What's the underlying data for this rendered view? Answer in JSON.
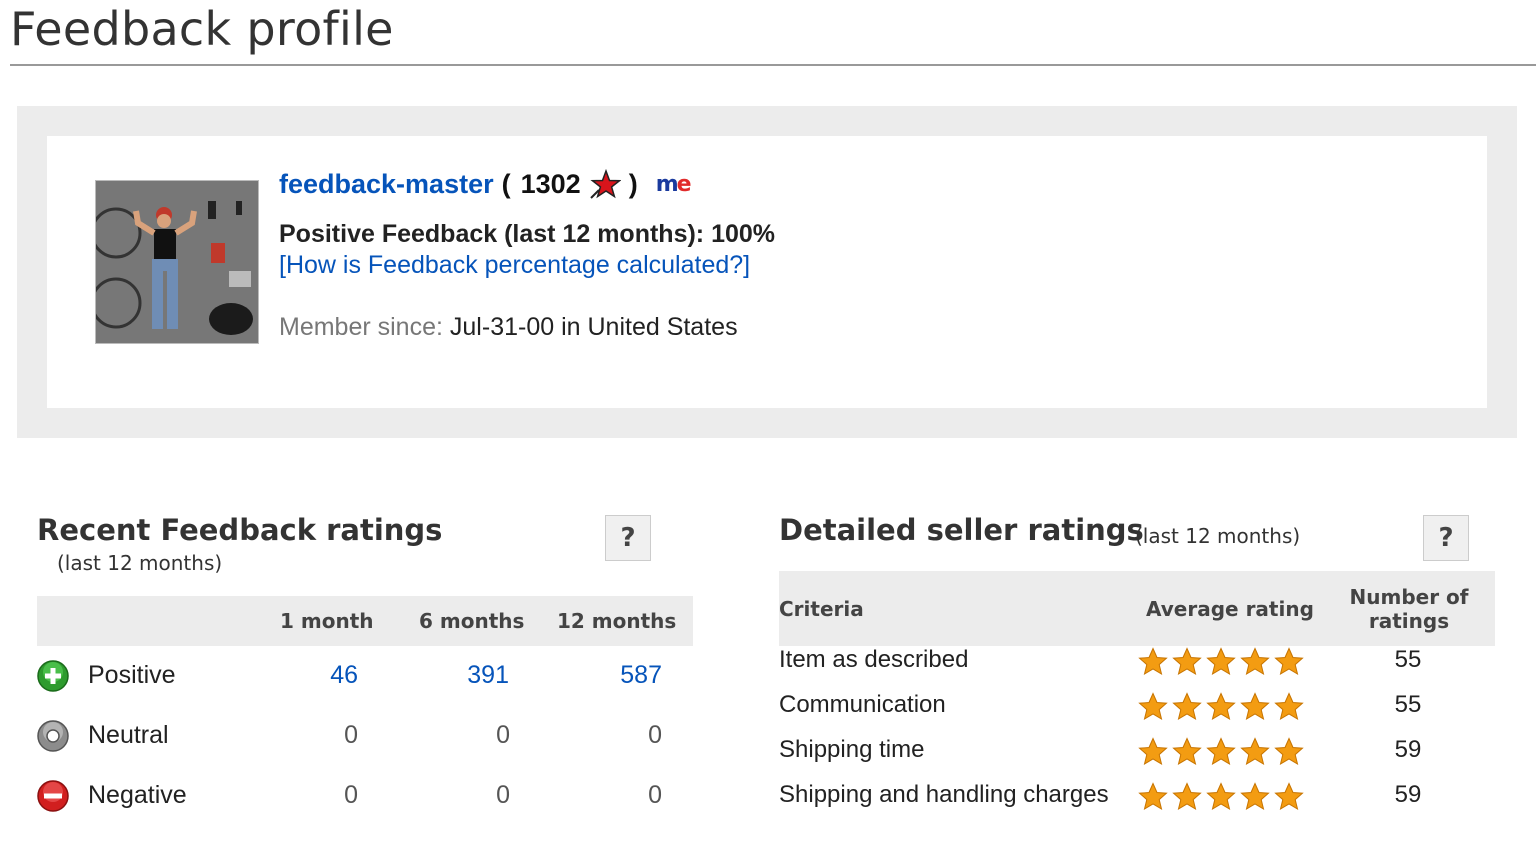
{
  "page": {
    "title": "Feedback profile"
  },
  "profile": {
    "username": "feedback-master",
    "paren_open": "(",
    "paren_close": ")",
    "score": "1302",
    "star_icon": "red-shooting-star-icon",
    "me_icon": {
      "m": "m",
      "e": "e"
    },
    "positive_feedback": "Positive Feedback (last 12 months): 100%",
    "how_link": "[How is Feedback percentage calculated?]",
    "member_since_label": "Member since:",
    "member_since_value": "Jul-31-00 in United States"
  },
  "recent": {
    "title": "Recent Feedback ratings",
    "subtitle": "(last 12 months)",
    "help": "?",
    "columns": [
      "1 month",
      "6 months",
      "12 months"
    ],
    "rows": [
      {
        "label": "Positive",
        "icon": "positive-plus-icon",
        "values": [
          "46",
          "391",
          "587"
        ]
      },
      {
        "label": "Neutral",
        "icon": "neutral-circle-icon",
        "values": [
          "0",
          "0",
          "0"
        ]
      },
      {
        "label": "Negative",
        "icon": "negative-minus-icon",
        "values": [
          "0",
          "0",
          "0"
        ]
      }
    ]
  },
  "detailed": {
    "title": "Detailed seller ratings",
    "subtitle": "(last 12 months)",
    "help": "?",
    "col_criteria": "Criteria",
    "col_avg": "Average rating",
    "col_num_1": "Number of",
    "col_num_2": "ratings",
    "rows": [
      {
        "criteria": "Item as described",
        "stars": 5,
        "count": "55"
      },
      {
        "criteria": "Communication",
        "stars": 5,
        "count": "55"
      },
      {
        "criteria": "Shipping time",
        "stars": 5,
        "count": "59"
      },
      {
        "criteria": "Shipping and handling charges",
        "stars": 5,
        "count": "59"
      }
    ]
  },
  "colors": {
    "link": "#0654ba",
    "star": "#f39c12",
    "panel": "#ececec"
  }
}
